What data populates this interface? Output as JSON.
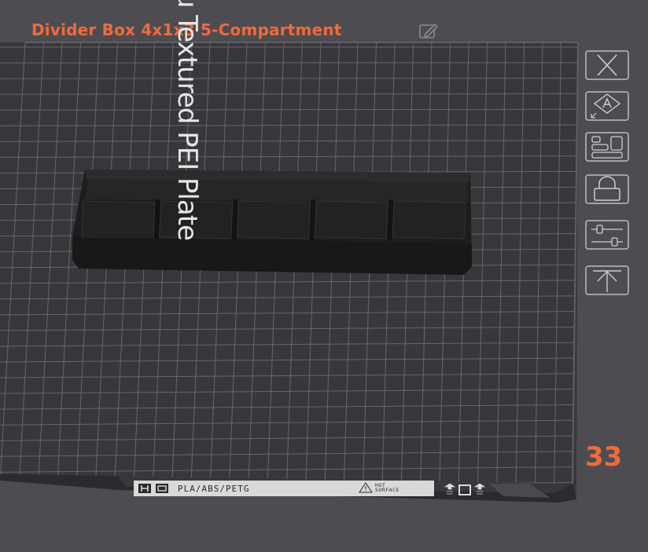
{
  "header": {
    "plate_title": "Divider Box 4x1x3 5-Compartment",
    "edit_icon": "pencil-edit-icon"
  },
  "plate": {
    "name": "Bambu Textured PEI Plate",
    "material_label": "PLA/ABS/PETG",
    "hot_surface_label": "HOT\nSURFACE",
    "warning_icon": "warning-triangle-icon",
    "index": "33"
  },
  "toolbar": {
    "items": [
      {
        "name": "delete-plate",
        "icon": "close-x-icon"
      },
      {
        "name": "auto-arrange",
        "icon": "arrange-a-icon"
      },
      {
        "name": "plate-settings",
        "icon": "plate-settings-icon"
      },
      {
        "name": "lock-plate",
        "icon": "lock-open-icon"
      },
      {
        "name": "plate-sliders",
        "icon": "sliders-icon"
      },
      {
        "name": "move-to-top",
        "icon": "arrow-up-icon"
      }
    ]
  },
  "model": {
    "compartments": 5
  },
  "colors": {
    "accent": "#f06a3c",
    "background": "#4d4d51",
    "plate": "#3a3a3e",
    "grid": "#6b6b70",
    "model": "#1f1f1f"
  }
}
